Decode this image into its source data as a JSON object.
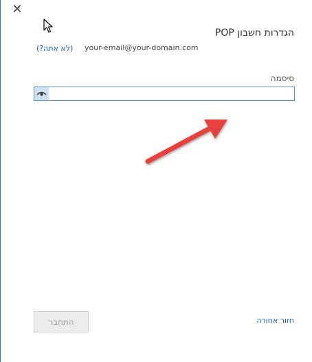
{
  "dialog": {
    "title": "הגדרות חשבון POP",
    "close_glyph": "✕",
    "account": {
      "email": "your-email@your-domain.com",
      "not_you_link": "(לא אתה?)"
    },
    "password": {
      "label": "סיסמה",
      "value": "",
      "placeholder": ""
    },
    "footer": {
      "back_link": "חזור אחורה",
      "connect_button": "התחבר",
      "connect_disabled": true
    }
  },
  "annotation": {
    "arrow_color": "#e8403a"
  },
  "colors": {
    "accent": "#2b79c2",
    "link": "#1a5fb4",
    "field_border": "#5a8fc7",
    "eye_bg": "#cde4f7",
    "disabled_button_bg": "#ececec"
  },
  "icons": [
    "close-icon",
    "mouse-cursor-icon",
    "eye-icon",
    "annotation-arrow"
  ]
}
